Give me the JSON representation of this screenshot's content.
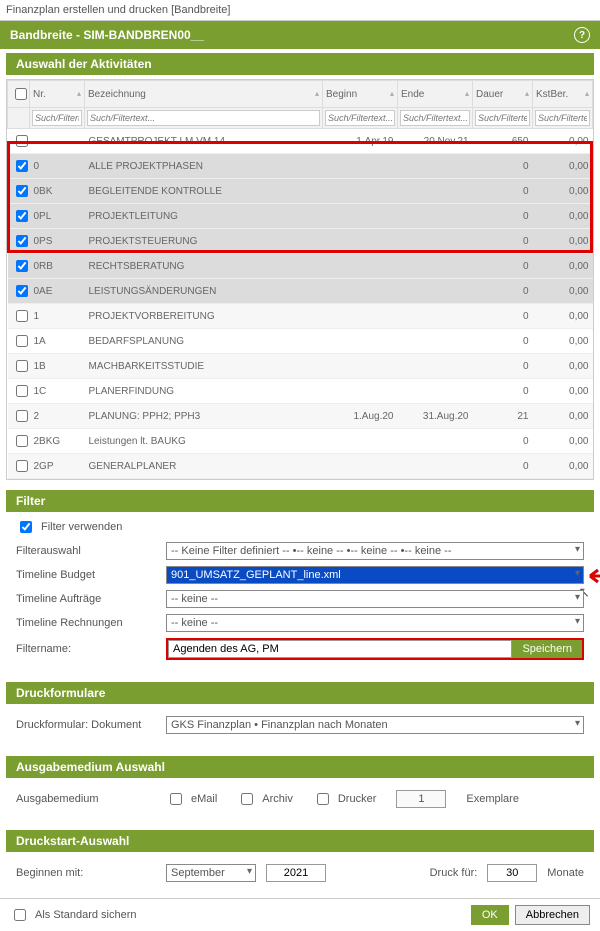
{
  "window_title": "Finanzplan erstellen und drucken [Bandbreite]",
  "header": "Bandbreite - SIM-BANDBREN00__",
  "section_activities": "Auswahl der Aktivitäten",
  "columns": {
    "nr": "Nr.",
    "bez": "Bezeichnung",
    "beginn": "Beginn",
    "ende": "Ende",
    "dauer": "Dauer",
    "kst": "KstBer."
  },
  "filter_placeholder": "Such/Filtertext...",
  "rows": [
    {
      "chk": false,
      "nr": "",
      "bez": "GESAMTPROJEKT LM.VM.14",
      "beginn": "1.Apr.19",
      "ende": "20.Nov.21",
      "dauer": "650",
      "kst": "0,00",
      "hl": false
    },
    {
      "chk": true,
      "nr": "0",
      "bez": "ALLE PROJEKTPHASEN",
      "beginn": "",
      "ende": "",
      "dauer": "0",
      "kst": "0,00",
      "hl": true
    },
    {
      "chk": true,
      "nr": "0BK",
      "bez": "BEGLEITENDE KONTROLLE",
      "beginn": "",
      "ende": "",
      "dauer": "0",
      "kst": "0,00",
      "hl": true
    },
    {
      "chk": true,
      "nr": "0PL",
      "bez": "PROJEKTLEITUNG",
      "beginn": "",
      "ende": "",
      "dauer": "0",
      "kst": "0,00",
      "hl": true
    },
    {
      "chk": true,
      "nr": "0PS",
      "bez": "PROJEKTSTEUERUNG",
      "beginn": "",
      "ende": "",
      "dauer": "0",
      "kst": "0,00",
      "hl": true
    },
    {
      "chk": true,
      "nr": "0RB",
      "bez": "RECHTSBERATUNG",
      "beginn": "",
      "ende": "",
      "dauer": "0",
      "kst": "0,00",
      "hl": true
    },
    {
      "chk": true,
      "nr": "0AE",
      "bez": "LEISTUNGSÄNDERUNGEN",
      "beginn": "",
      "ende": "",
      "dauer": "0",
      "kst": "0,00",
      "hl": true
    },
    {
      "chk": false,
      "nr": "1",
      "bez": "PROJEKTVORBEREITUNG",
      "beginn": "",
      "ende": "",
      "dauer": "0",
      "kst": "0,00",
      "hl": false
    },
    {
      "chk": false,
      "nr": "1A",
      "bez": "BEDARFSPLANUNG",
      "beginn": "",
      "ende": "",
      "dauer": "0",
      "kst": "0,00",
      "hl": false
    },
    {
      "chk": false,
      "nr": "1B",
      "bez": "MACHBARKEITSSTUDIE",
      "beginn": "",
      "ende": "",
      "dauer": "0",
      "kst": "0,00",
      "hl": false
    },
    {
      "chk": false,
      "nr": "1C",
      "bez": "PLANERFINDUNG",
      "beginn": "",
      "ende": "",
      "dauer": "0",
      "kst": "0,00",
      "hl": false
    },
    {
      "chk": false,
      "nr": "2",
      "bez": "PLANUNG: PPH2; PPH3",
      "beginn": "1.Aug.20",
      "ende": "31.Aug.20",
      "dauer": "21",
      "kst": "0,00",
      "hl": false
    },
    {
      "chk": false,
      "nr": "2BKG",
      "bez": "Leistungen lt. BAUKG",
      "beginn": "",
      "ende": "",
      "dauer": "0",
      "kst": "0,00",
      "hl": false
    },
    {
      "chk": false,
      "nr": "2GP",
      "bez": "GENERALPLANER",
      "beginn": "",
      "ende": "",
      "dauer": "0",
      "kst": "0,00",
      "hl": false
    }
  ],
  "filter": {
    "title": "Filter",
    "use_filter": "Filter verwenden",
    "auswahl_label": "Filterauswahl",
    "auswahl_value": "-- Keine Filter definiert -- •-- keine -- •-- keine -- •-- keine --",
    "budget_label": "Timeline Budget",
    "budget_value": "901_UMSATZ_GEPLANT_line.xml",
    "auftrage_label": "Timeline Aufträge",
    "auftrage_value": "-- keine --",
    "rechnungen_label": "Timeline Rechnungen",
    "rechnungen_value": "-- keine --",
    "name_label": "Filtername:",
    "name_value": "Agenden des AG, PM",
    "save": "Speichern"
  },
  "druckform": {
    "title": "Druckformulare",
    "label": "Druckformular: Dokument",
    "value": "GKS Finanzplan • Finanzplan nach Monaten"
  },
  "ausgabe": {
    "title": "Ausgabemedium Auswahl",
    "label": "Ausgabemedium",
    "email": "eMail",
    "archiv": "Archiv",
    "drucker": "Drucker",
    "exemplare_val": "1",
    "exemplare": "Exemplare"
  },
  "druckstart": {
    "title": "Druckstart-Auswahl",
    "label": "Beginnen mit:",
    "month": "September",
    "year": "2021",
    "druckfur": "Druck für:",
    "val": "30",
    "monate": "Monate"
  },
  "footer": {
    "standard": "Als Standard sichern",
    "ok": "OK",
    "cancel": "Abbrechen"
  }
}
